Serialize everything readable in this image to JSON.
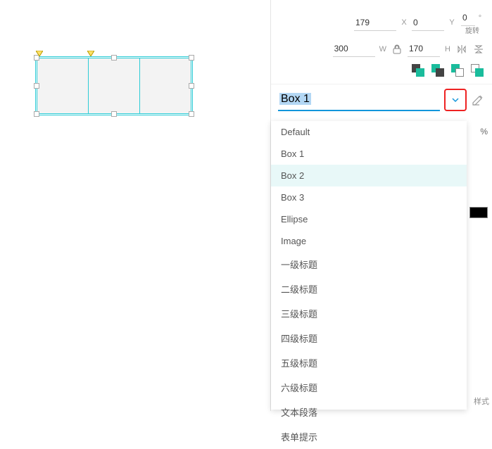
{
  "position": {
    "xLabel": "X",
    "xValue": "179",
    "yLabel": "Y",
    "yValue": "0",
    "degreeSymbol": "°",
    "rotateLabel": "旋转"
  },
  "size": {
    "wValue": "300",
    "wLabel": "W",
    "hValue": "170",
    "hLabel": "H"
  },
  "stylePicker": {
    "current": "Box 1",
    "tooltip": "Box 2"
  },
  "styleOptions": [
    "Default",
    "Box 1",
    "Box 2",
    "Box 3",
    "Ellipse",
    "Image",
    "一级标题",
    "二级标题",
    "三级标题",
    "四级标题",
    "五级标题",
    "六级标题",
    "文本段落",
    "表单提示"
  ],
  "peek": {
    "percent": "%",
    "styleHint": "样式"
  }
}
